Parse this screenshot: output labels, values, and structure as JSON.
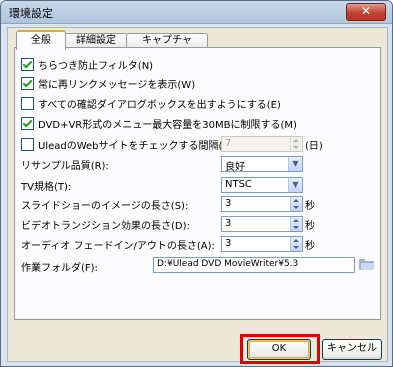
{
  "window": {
    "title": "環境設定",
    "close_label": "✕"
  },
  "tabs": [
    {
      "label": "全般",
      "active": true
    },
    {
      "label": "詳細設定",
      "active": false
    },
    {
      "label": "キャプチャ",
      "active": false
    }
  ],
  "options": {
    "flicker": {
      "label": "ちらつき防止フィルタ(N)",
      "checked": true
    },
    "relink": {
      "label": "常に再リンクメッセージを表示(W)",
      "checked": true
    },
    "confirm_dialogs": {
      "label": "すべての確認ダイアログボックスを出すようにする(E)",
      "checked": false
    },
    "dvd_menu_limit": {
      "label": "DVD+VR形式のメニュー最大容量を30MBに制限する(M)",
      "checked": true
    },
    "web_check": {
      "label": "UleadのWebサイトをチェックする間隔(C):",
      "checked": false,
      "value": "7",
      "unit": "(日)"
    }
  },
  "fields": {
    "resample": {
      "label": "リサンプル品質(R):",
      "value": "良好"
    },
    "tv_standard": {
      "label": "TV規格(T):",
      "value": "NTSC"
    },
    "slideshow": {
      "label": "スライドショーのイメージの長さ(S):",
      "value": "3",
      "unit": "秒"
    },
    "transition": {
      "label": "ビデオトランジション効果の長さ(D):",
      "value": "3",
      "unit": "秒"
    },
    "audio_fade": {
      "label": "オーディオ フェードイン/アウトの長さ(A):",
      "value": "3",
      "unit": "秒"
    },
    "work_folder": {
      "label": "作業フォルダ(F):",
      "value": "D:¥Ulead DVD MovieWriter¥5.3"
    }
  },
  "buttons": {
    "ok": "OK",
    "cancel": "キャンセル"
  },
  "colors": {
    "highlight": "#e00000",
    "tab_accent": "#f0a12f",
    "check": "#21a121"
  }
}
